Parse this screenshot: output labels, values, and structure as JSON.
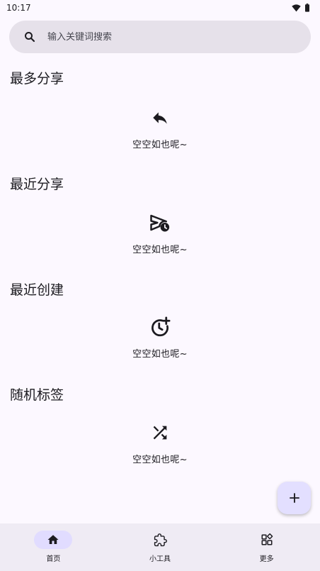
{
  "status_bar": {
    "time": "10:17"
  },
  "search": {
    "placeholder": "输入关键词搜索"
  },
  "sections": [
    {
      "title": "最多分享",
      "empty_text": "空空如也呢~",
      "icon": "reply-icon"
    },
    {
      "title": "最近分享",
      "empty_text": "空空如也呢~",
      "icon": "scheduled-send-icon"
    },
    {
      "title": "最近创建",
      "empty_text": "空空如也呢~",
      "icon": "history-add-icon"
    },
    {
      "title": "随机标签",
      "empty_text": "空空如也呢~",
      "icon": "shuffle-icon"
    }
  ],
  "fab": {
    "icon": "add-icon"
  },
  "bottom_nav": {
    "items": [
      {
        "label": "首页",
        "icon": "home-icon",
        "active": true
      },
      {
        "label": "小工具",
        "icon": "puzzle-icon",
        "active": false
      },
      {
        "label": "更多",
        "icon": "widgets-icon",
        "active": false
      }
    ]
  },
  "colors": {
    "background": "#fcf8ff",
    "search_bg": "#e6e1ea",
    "fab_bg": "#e3dfff",
    "nav_bg": "#efebf4",
    "nav_active_pill": "#e1dcff",
    "text": "#1c1b20"
  }
}
